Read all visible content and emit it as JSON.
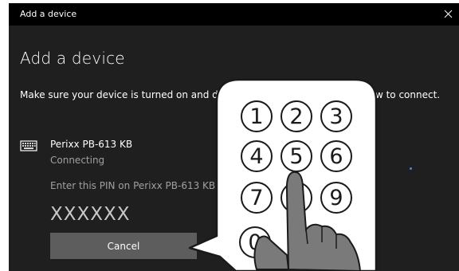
{
  "window": {
    "title": "Add a device",
    "heading": "Add a device",
    "intro_text": "Make sure your device is turned on and discoverable. Select a device below to connect.",
    "close_icon": "close-icon"
  },
  "device": {
    "icon": "keyboard-icon",
    "name": "Perixx PB-613 KB",
    "status": "Connecting",
    "pin_message": "Enter this PIN on Perixx PB-613 KB",
    "pin": "XXXXXX"
  },
  "buttons": {
    "cancel_label": "Cancel"
  },
  "keypad": {
    "keys": [
      "1",
      "2",
      "3",
      "4",
      "5",
      "6",
      "7",
      "8",
      "9",
      "0"
    ],
    "hand_icon": "pointing-hand-icon"
  },
  "colors": {
    "window_bg": "#1f1f1f",
    "titlebar_bg": "#000000",
    "button_bg": "#5d5d5d",
    "secondary_text": "#a0a0a0",
    "accent": "#3a8ee6"
  }
}
